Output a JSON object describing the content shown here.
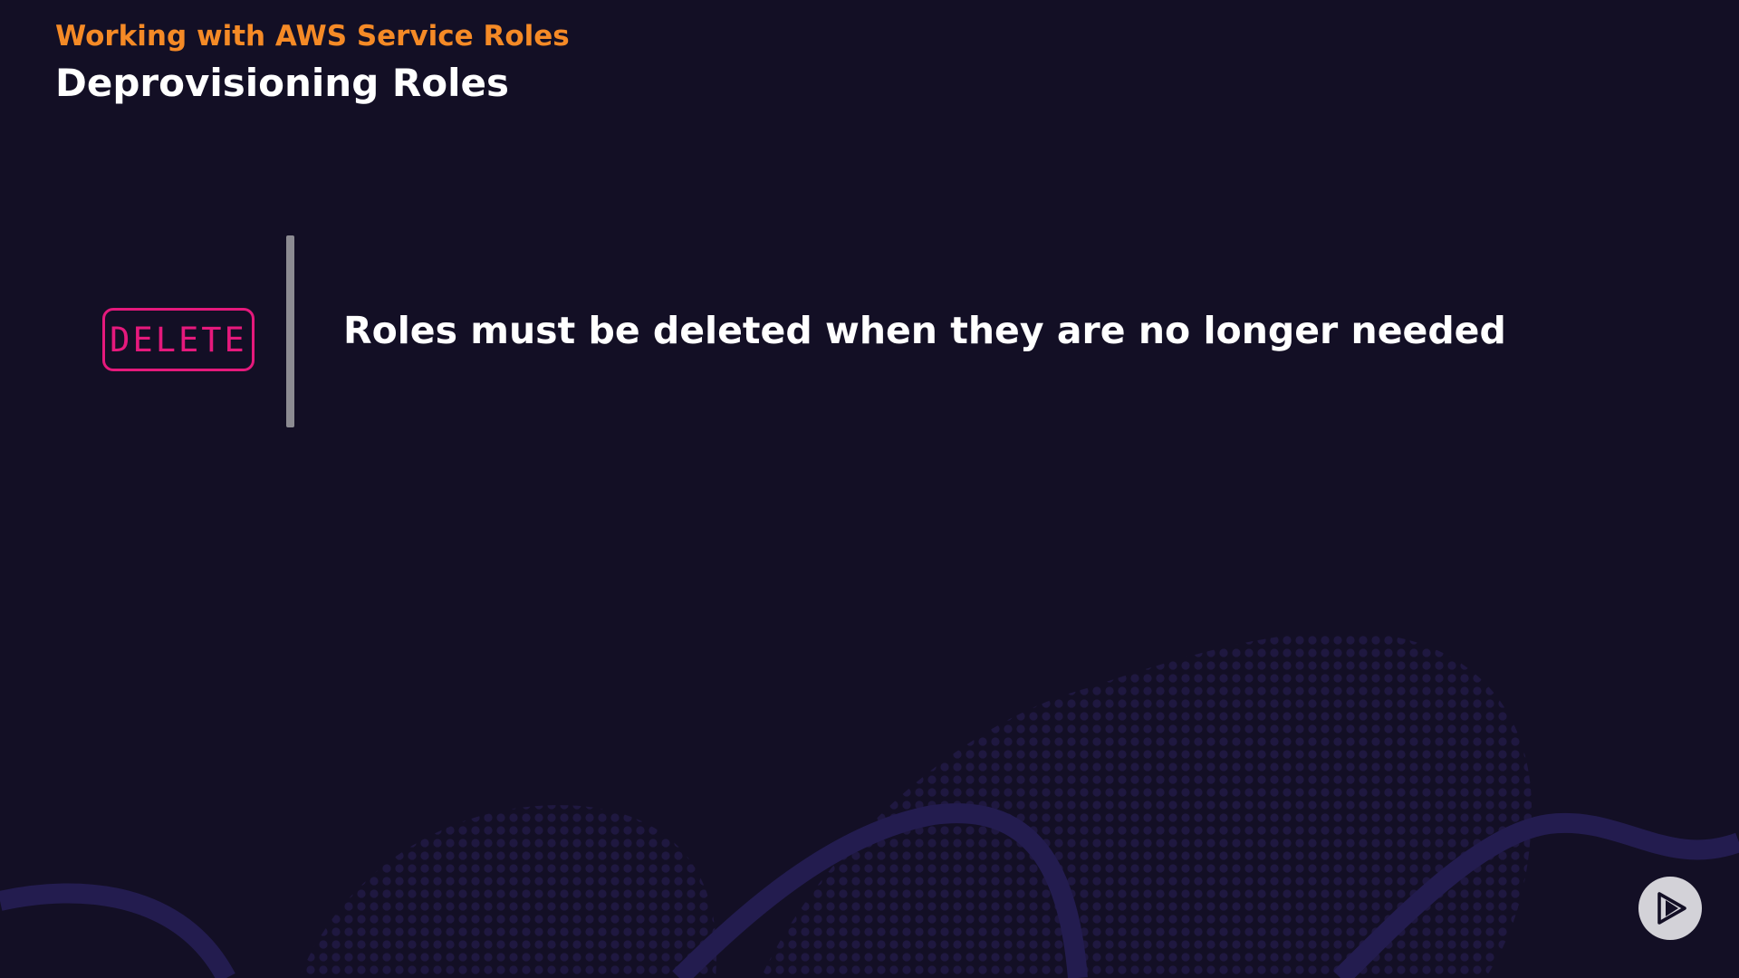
{
  "header": {
    "course_title": "Working with AWS Service Roles",
    "slide_title": "Deprovisioning Roles"
  },
  "content": {
    "badge_label": "DELETE",
    "statement": "Roles must be deleted when they are no longer needed"
  },
  "icons": {
    "brand_logo": "play-logo-icon",
    "badge_style": "rounded-rectangle-outline"
  },
  "colors": {
    "background": "#130f25",
    "accent_orange": "#f58a26",
    "accent_pink": "#e5197c",
    "divider_gray": "#8c8b92",
    "decoration_wave": "#231c4f",
    "logo_circle": "#d3d2d8"
  }
}
